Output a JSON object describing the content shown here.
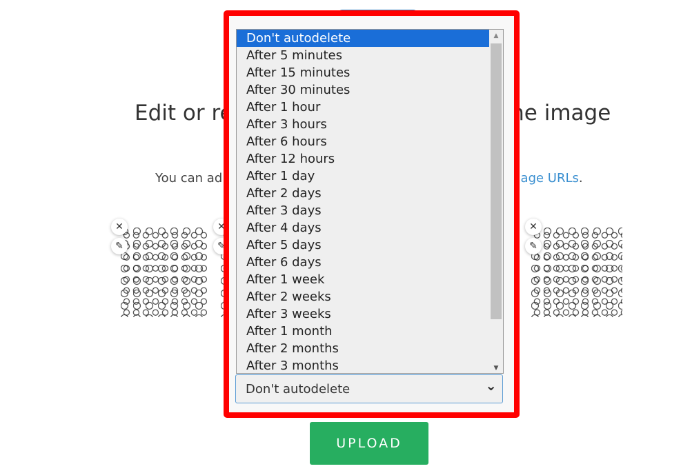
{
  "page": {
    "title_left": "Edit or res",
    "title_right": "the image",
    "subtitle_left": "You can ad",
    "subtitle_link": "image URLs",
    "subtitle_end": "."
  },
  "thumbnails": [
    {
      "remove": "✕",
      "edit": "✎"
    },
    {
      "remove": "✕",
      "edit": "✎"
    },
    {
      "remove": "✕",
      "edit": "✎"
    }
  ],
  "autodelete": {
    "selected": "Don't autodelete",
    "options": [
      "Don't autodelete",
      "After 5 minutes",
      "After 15 minutes",
      "After 30 minutes",
      "After 1 hour",
      "After 3 hours",
      "After 6 hours",
      "After 12 hours",
      "After 1 day",
      "After 2 days",
      "After 3 days",
      "After 4 days",
      "After 5 days",
      "After 6 days",
      "After 1 week",
      "After 2 weeks",
      "After 3 weeks",
      "After 1 month",
      "After 2 months",
      "After 3 months"
    ],
    "chevron": "⌄"
  },
  "upload_label": "UPLOAD",
  "colors": {
    "highlight": "#ff0000",
    "selected_option": "#1a6ed8",
    "upload": "#27ae60",
    "link": "#3a8fd0"
  }
}
